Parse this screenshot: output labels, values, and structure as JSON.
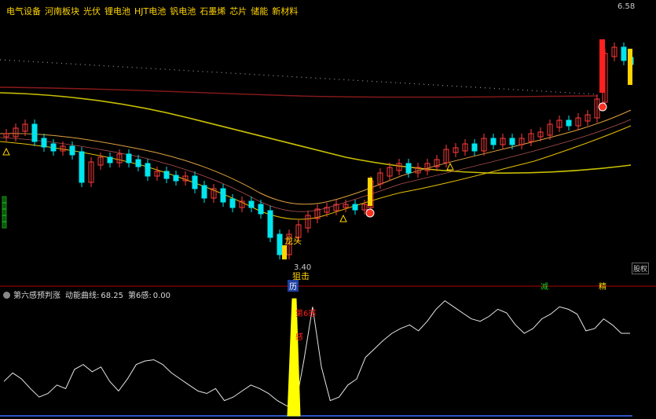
{
  "header": {
    "concepts": [
      "电气设备",
      "河南板块",
      "光伏",
      "锂电池",
      "HJT电池",
      "钒电池",
      "石墨烯",
      "芯片",
      "储能",
      "新材料"
    ]
  },
  "panel2": {
    "title": "第六感预判涨",
    "curve_label": "动能曲线:",
    "curve_value": "68.25",
    "sixth_label": "第6感:",
    "sixth_value": "0.00"
  },
  "annotations": {
    "high_price": "6.58",
    "low_price": "3.40",
    "label_dragon": "龙头",
    "label_snipe": "狙击",
    "label_history": "历",
    "label_cut": "减",
    "label_lock": "精",
    "label_right": "股权",
    "sixth_sense_mark": "第6感",
    "sixth_sense_short": "感"
  },
  "colors": {
    "up": "#ff3b3b",
    "down": "#00e5ee",
    "ma_yellow": "#c8c000",
    "band_upper": "#e0a040",
    "band_lower": "#e8c000",
    "signal_yellow": "#ffff00",
    "momentum_line": "#e6e6e6"
  },
  "chart_data": {
    "type": "candlestick",
    "series_count": 56,
    "high_marker": 6.58,
    "low_marker": 3.4,
    "momentum_curve": [
      28,
      35,
      30,
      22,
      15,
      18,
      25,
      22,
      38,
      42,
      36,
      40,
      28,
      20,
      30,
      42,
      45,
      46,
      42,
      35,
      30,
      25,
      20,
      18,
      22,
      12,
      15,
      20,
      25,
      22,
      18,
      12,
      8,
      5,
      45,
      90,
      40,
      12,
      15,
      25,
      30,
      48,
      55,
      62,
      68,
      72,
      75,
      70,
      78,
      88,
      95,
      90,
      85,
      80,
      78,
      82,
      88,
      85,
      75,
      68,
      72,
      80,
      84,
      90,
      88,
      84,
      70,
      72,
      80,
      75,
      68,
      68
    ]
  }
}
